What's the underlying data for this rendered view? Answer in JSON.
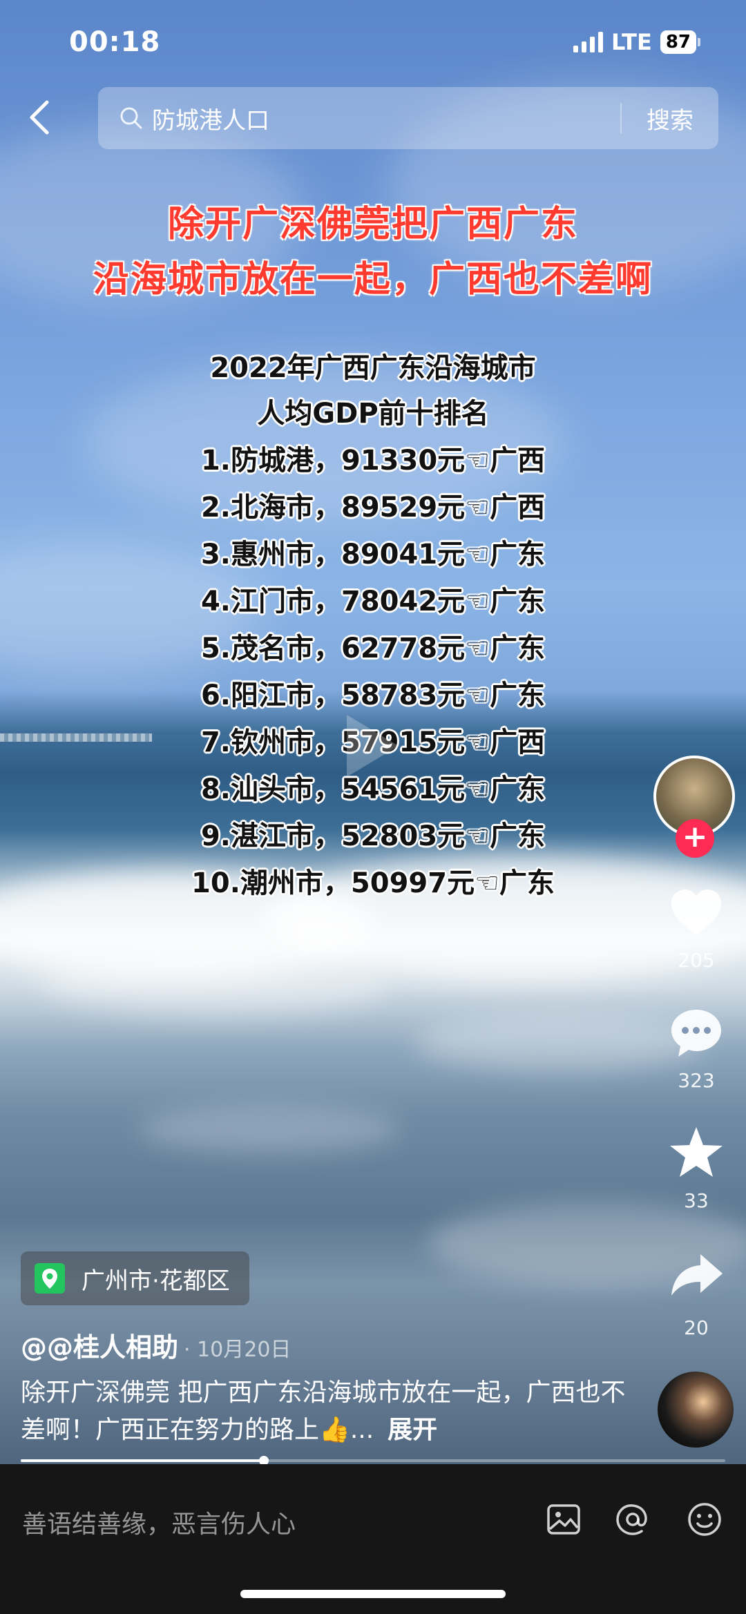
{
  "status_bar": {
    "time": "00:18",
    "network": "LTE",
    "battery": "87"
  },
  "search": {
    "query": "防城港人口",
    "button_label": "搜索"
  },
  "video": {
    "headline": [
      "除开广深佛莞把广西广东",
      "沿海城市放在一起，广西也不差啊"
    ],
    "ranking_title": [
      "2022年广西广东沿海城市",
      "人均GDP前十排名"
    ],
    "ranking": [
      "1.防城港，91330元☜广西",
      "2.北海市，89529元☜广西",
      "3.惠州市，89041元☜广东",
      "4.江门市，78042元☜广东",
      "5.茂名市，62778元☜广东",
      "6.阳江市，58783元☜广东",
      "7.钦州市，57915元☜广西",
      "8.汕头市，54561元☜广东",
      "9.湛江市，52803元☜广东",
      "10.潮州市，50997元☜广东"
    ]
  },
  "actions": {
    "likes": "205",
    "comments": "323",
    "favorites": "33",
    "shares": "20"
  },
  "post": {
    "location": "广州市·花都区",
    "author": "@@桂人相助",
    "date": "· 10月20日",
    "caption": "除开广深佛莞 把广西广东沿海城市放在一起，广西也不差啊！广西正在努力的路上👍...",
    "expand_label": "展开",
    "progress": 0.345
  },
  "comment_bar": {
    "placeholder": "善语结善缘，恶言伤人心"
  },
  "colors": {
    "headline": "#ff3b2f",
    "follow": "#fe2c55",
    "location_pin": "#22c55e"
  }
}
